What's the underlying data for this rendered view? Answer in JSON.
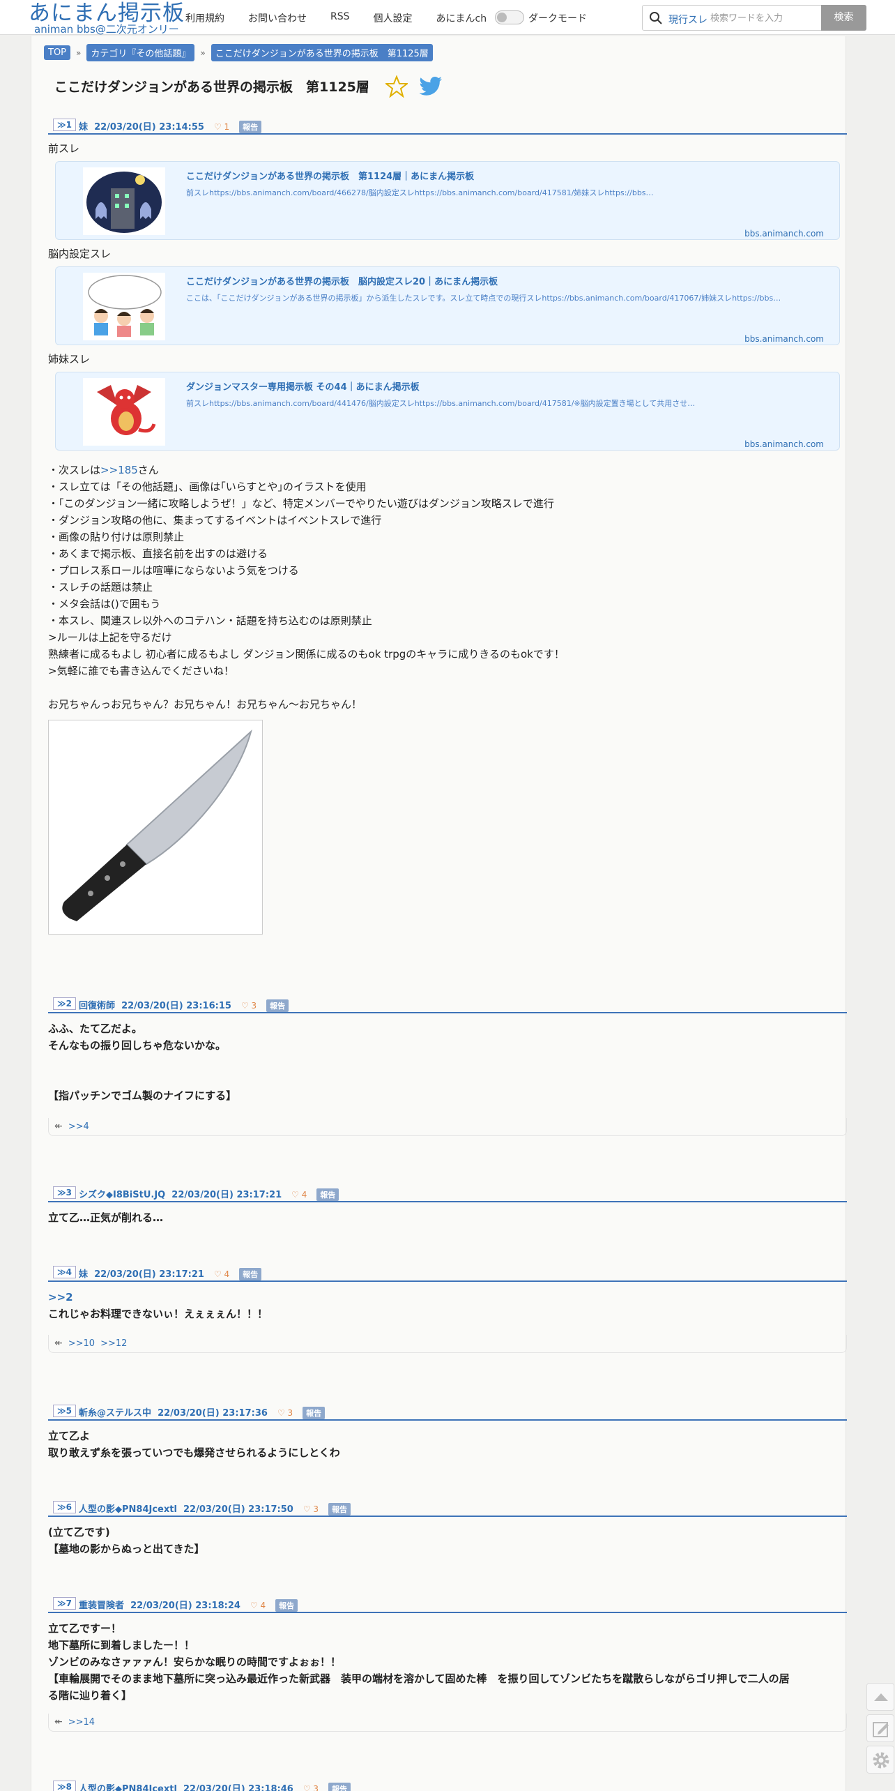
{
  "header": {
    "logo_title": "あにまん掲示板",
    "logo_sub": "animan bbs@二次元オンリー",
    "nav": [
      "利用規約",
      "お問い合わせ",
      "RSS",
      "個人設定",
      "あにまんch"
    ],
    "dark_mode_label": "ダークモード",
    "search_scope": "現行スレ",
    "search_placeholder": "検索ワードを入力",
    "search_button": "検索"
  },
  "breadcrumb": [
    "TOP",
    "カテゴリ『その他話題』",
    "ここだけダンジョンがある世界の掲示板　第1125層"
  ],
  "breadcrumb_sep": "»",
  "thread_title": "ここだけダンジョンがある世界の掲示板　第1125層",
  "posts": [
    {
      "num": "1",
      "name": "妹",
      "date": "22/03/20(日) 23:14:55",
      "likes": "1",
      "report": "報告",
      "sections": [
        {
          "label": "前スレ",
          "card": {
            "title": "ここだけダンジョンがある世界の掲示板　第1124層｜あにまん掲示板",
            "desc": "前スレhttps://bbs.animanch.com/board/466278/脳内設定スレhttps://bbs.animanch.com/board/417581/姉妹スレhttps://bbs…",
            "domain": "bbs.animanch.com",
            "image": "haunted-building"
          }
        },
        {
          "label": "脳内設定スレ",
          "card": {
            "title": "ここだけダンジョンがある世界の掲示板　脳内設定スレ20｜あにまん掲示板",
            "desc": "ここは、「ここだけダンジョンがある世界の掲示板」から派生したスレです。スレ立て時点での現行スレhttps://bbs.animanch.com/board/417067/姉妹スレhttps://bbs…",
            "domain": "bbs.animanch.com",
            "image": "thinking-kids"
          }
        },
        {
          "label": "姉妹スレ",
          "card": {
            "title": "ダンジョンマスター専用掲示板 その44｜あにまん掲示板",
            "desc": "前スレhttps://bbs.animanch.com/board/441476/脳内設定スレhttps://bbs.animanch.com/board/417581/※脳内設定置き場として共用させ…",
            "domain": "bbs.animanch.com",
            "image": "red-dragon"
          }
        }
      ],
      "rules_next_prefix": "・次スレは",
      "rules_next_anchor": ">>185",
      "rules_next_suffix": "さん",
      "rules": [
        "・スレ立ては「その他話題」、画像は｢いらすとや｣のイラストを使用",
        "・「このダンジョン一緒に攻略しようぜ！」など、特定メンバーでやりたい遊びはダンジョン攻略スレで進行",
        "・ダンジョン攻略の他に、集まってするイベントはイベントスレで進行",
        "・画像の貼り付けは原則禁止",
        "・あくまで掲示板、直接名前を出すのは避ける",
        "・プロレス系ロールは喧嘩にならないよう気をつける",
        "・スレチの話題は禁止",
        "・メタ会話は()で囲もう",
        "・本スレ、関連スレ以外へのコテハン・話題を持ち込むのは原則禁止",
        ">ルールは上記を守るだけ",
        "熟練者に成るもよし 初心者に成るもよし ダンジョン関係に成るのもok trpgのキャラに成りきるのもokです！",
        ">気軽に誰でも書き込んでくださいね！"
      ],
      "closing": "お兄ちゃんっお兄ちゃん？お兄ちゃん！お兄ちゃん〜お兄ちゃん！",
      "image": "kitchen-knife"
    },
    {
      "num": "2",
      "name": "回復術師",
      "date": "22/03/20(日) 23:16:15",
      "likes": "3",
      "report": "報告",
      "lines": [
        "ふふ、たて乙だよ。",
        "そんなもの振り回しちゃ危ないかな。",
        "",
        "",
        "【指パッチンでゴム製のナイフにする】"
      ],
      "replies": [
        ">>4"
      ]
    },
    {
      "num": "3",
      "name": "シズク◆I8BiStU.JQ",
      "date": "22/03/20(日) 23:17:21",
      "likes": "4",
      "report": "報告",
      "lines": [
        "立て乙…正気が削れる…"
      ],
      "replies": []
    },
    {
      "num": "4",
      "name": "妹",
      "date": "22/03/20(日) 23:17:21",
      "likes": "4",
      "report": "報告",
      "anchor": ">>2",
      "lines": [
        "これじゃお料理できないぃ！えぇぇぇん！！！"
      ],
      "replies": [
        ">>10",
        ">>12"
      ]
    },
    {
      "num": "5",
      "name": "斬糸@ステルス中",
      "date": "22/03/20(日) 23:17:36",
      "likes": "3",
      "report": "報告",
      "lines": [
        "立て乙よ",
        "取り敢えず糸を張っていつでも爆発させられるようにしとくわ"
      ],
      "replies": []
    },
    {
      "num": "6",
      "name": "人型の影◆PN84Jcextl",
      "date": "22/03/20(日) 23:17:50",
      "likes": "3",
      "report": "報告",
      "lines": [
        "(立て乙です)",
        "【墓地の影からぬっと出てきた】"
      ],
      "replies": []
    },
    {
      "num": "7",
      "name": "重装冒険者",
      "date": "22/03/20(日) 23:18:24",
      "likes": "4",
      "report": "報告",
      "lines": [
        "立て乙ですー！",
        "地下墓所に到着しましたー！！",
        "ゾンビのみなさァァァん！安らかな眠りの時間ですよぉぉ！！",
        "【車輪展開でそのまま地下墓所に突っ込み最近作った新武器　装甲の端材を溶かして固めた棒　を振り回してゾンビたちを蹴散らしながらゴリ押しで二人の居",
        "る階に辿り着く】"
      ],
      "replies": [
        ">>14"
      ]
    },
    {
      "num": "8",
      "name": "人型の影◆PN84Jcextl",
      "date": "22/03/20(日) 23:18:46",
      "likes": "3",
      "report": "報告"
    }
  ],
  "colors": {
    "accent": "#2f6fb4",
    "rule": "#3e73b8",
    "like": "#e0884a"
  }
}
